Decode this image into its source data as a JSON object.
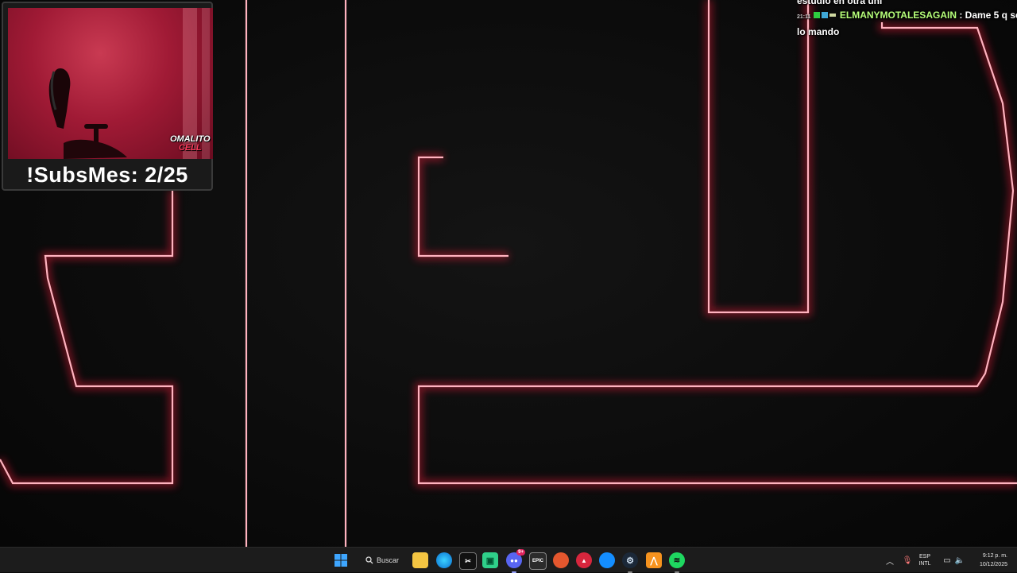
{
  "webcam": {
    "logo_line1": "OMALITO",
    "logo_line2": "CELL",
    "subs_label": "!SubsMes: 2/25"
  },
  "chat": {
    "partial_line": "estudio en otra uni",
    "message": {
      "time": "21:11",
      "username": "ELMANYMOTALESAGAIN",
      "text_line1": ": Dame 5 q se",
      "text_line2": "lo mando"
    }
  },
  "taskbar": {
    "search_label": "Buscar",
    "apps": [
      "start-icon",
      "file-explorer-icon",
      "edge-icon",
      "capcut-icon",
      "android-app-icon",
      "discord-icon",
      "epic-games-icon",
      "origin-icon",
      "ea-app-icon",
      "battle-net-icon",
      "steam-icon",
      "fl-studio-icon",
      "spotify-icon"
    ],
    "discord_badge": "9+",
    "language_line1": "ESP",
    "language_line2": "INTL",
    "time": "9:12 p. m.",
    "date": "10/12/2025"
  },
  "colors": {
    "neon": "#ff1e3c",
    "neon_core": "#ffb3bf",
    "chat_username": "#b7ff7a",
    "taskbar_bg": "#1c1c1c"
  }
}
